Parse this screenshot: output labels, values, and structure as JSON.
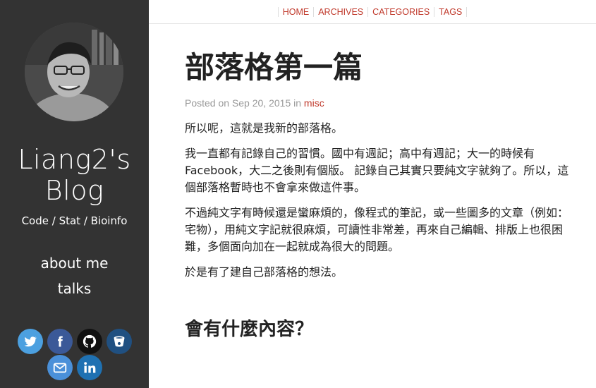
{
  "topnav": {
    "items": [
      "HOME",
      "ARCHIVES",
      "CATEGORIES",
      "TAGS"
    ]
  },
  "sidebar": {
    "title_line1": "Liang2's",
    "title_line2": "Blog",
    "subtitle": "Code / Stat / Bioinfo",
    "links": [
      "about me",
      "talks"
    ],
    "social_icons": [
      "twitter-icon",
      "facebook-icon",
      "github-icon",
      "bitbucket-icon",
      "email-icon",
      "linkedin-icon"
    ]
  },
  "post": {
    "title": "部落格第一篇",
    "meta_prefix": "Posted on Sep 20, 2015 in ",
    "category": "misc",
    "paragraphs": [
      "所以呢，這就是我新的部落格。",
      "我一直都有記錄自己的習慣。國中有週記；高中有週記；大一的時候有 Facebook，大二之後則有個版。 記錄自己其實只要純文字就夠了。所以，這個部落格暫時也不會拿來做這件事。",
      "不過純文字有時候還是蠻麻煩的，像程式的筆記，或一些圖多的文章（例如：宅物），用純文字記就很麻煩，可讀性非常差，再來自己編輯、排版上也很困難，多個面向加在一起就成為很大的問題。",
      "於是有了建自己部落格的想法。"
    ],
    "heading2": "會有什麼內容？"
  },
  "colors": {
    "sidebar_bg": "#333333",
    "accent": "#c0392b",
    "twitter": "#4ca0e0",
    "facebook": "#3b5998",
    "github": "#111111",
    "bitbucket": "#205081",
    "email": "#4a90d9",
    "linkedin": "#1f71b2"
  }
}
